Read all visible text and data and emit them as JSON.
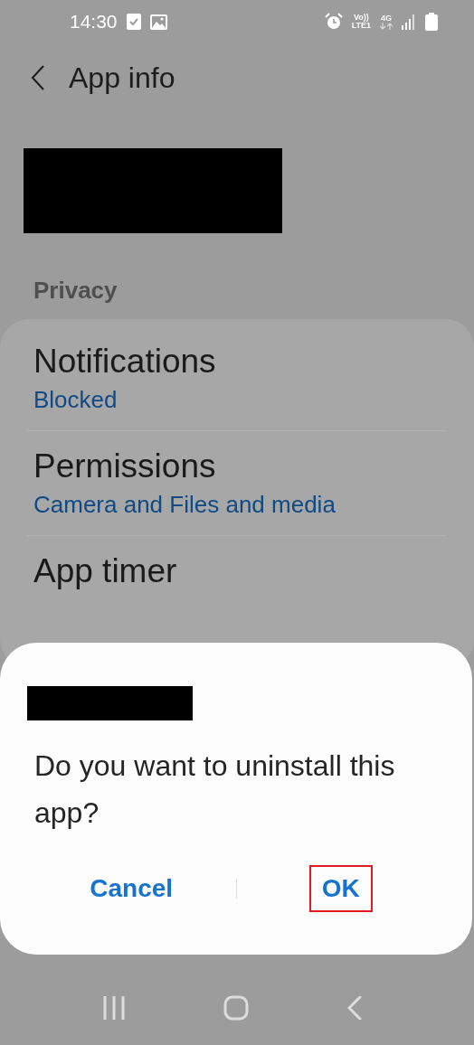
{
  "status_bar": {
    "time": "14:30",
    "volte": "Vo))",
    "lte": "LTE1",
    "network": "4G"
  },
  "header": {
    "title": "App info"
  },
  "section": {
    "title": "Privacy"
  },
  "settings": [
    {
      "title": "Notifications",
      "subtitle": "Blocked"
    },
    {
      "title": "Permissions",
      "subtitle": "Camera and Files and media"
    },
    {
      "title": "App timer"
    }
  ],
  "dialog": {
    "message": "Do you want to uninstall this app?",
    "buttons": [
      {
        "label": "Cancel",
        "highlighted": false
      },
      {
        "label": "OK",
        "highlighted": true
      }
    ]
  }
}
